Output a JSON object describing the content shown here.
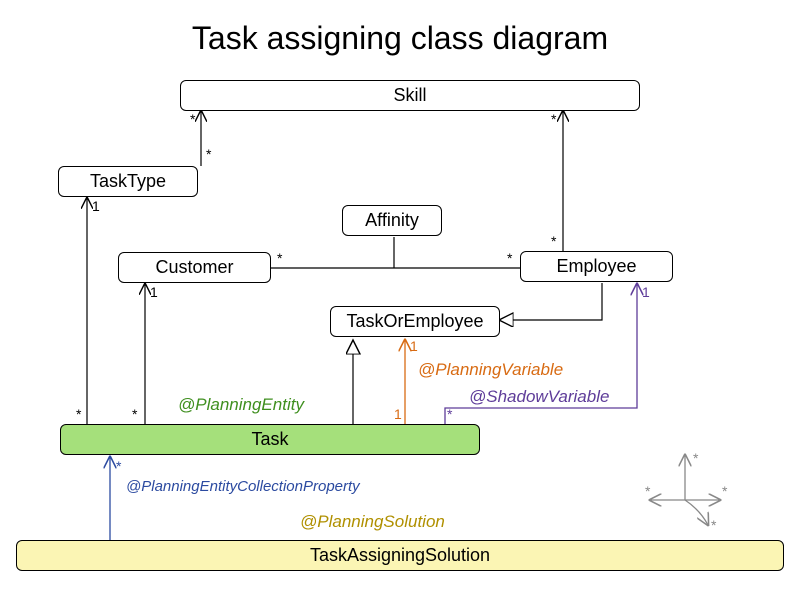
{
  "title": "Task assigning class diagram",
  "classes": {
    "skill": "Skill",
    "taskType": "TaskType",
    "affinity": "Affinity",
    "customer": "Customer",
    "employee": "Employee",
    "taskOrEmployee": "TaskOrEmployee",
    "task": "Task",
    "solution": "TaskAssigningSolution"
  },
  "annotations": {
    "planningEntity": "@PlanningEntity",
    "planningVariable": "@PlanningVariable",
    "shadowVariable": "@ShadowVariable",
    "planningEntityCollectionProperty": "@PlanningEntityCollectionProperty",
    "planningSolution": "@PlanningSolution"
  },
  "mult": {
    "star": "*",
    "one": "1"
  },
  "colors": {
    "planningEntity": "#3f8f1f",
    "planningVariable": "#d86b13",
    "shadowVariable": "#5e3c99",
    "collectionProp": "#2b4aa0",
    "planningSolution": "#b09000"
  }
}
